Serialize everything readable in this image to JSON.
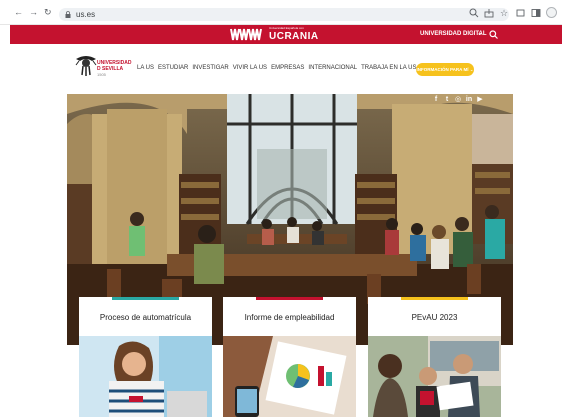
{
  "browser": {
    "url": "us.es"
  },
  "banner": {
    "sublabel": "Universidad Española con",
    "brand": "UCRANIA",
    "digital_label": "UNIVERSIDAD DIGITAL"
  },
  "header": {
    "university_name": [
      "UNIVERSIDAD",
      "D SEVILLA"
    ],
    "university_tag": "1505",
    "nav_items": [
      "LA US",
      "ESTUDIAR",
      "INVESTIGAR",
      "VIVIR LA US",
      "EMPRESAS",
      "INTERNACIONAL",
      "TRABAJA EN LA US"
    ],
    "info_button": "INFORMACIÓN PARA MÍ"
  },
  "social": [
    "f",
    "t",
    "ig",
    "in",
    "yt"
  ],
  "cards": [
    {
      "title": "Proceso de automatrícula",
      "accent": "#2aa9a4"
    },
    {
      "title": "Informe de empleabilidad",
      "accent": "#c4122f"
    },
    {
      "title": "PEvAU 2023",
      "accent": "#f6c21d"
    }
  ],
  "colors": {
    "brand_red": "#c4122f",
    "info_yellow": "#f6c21d"
  }
}
